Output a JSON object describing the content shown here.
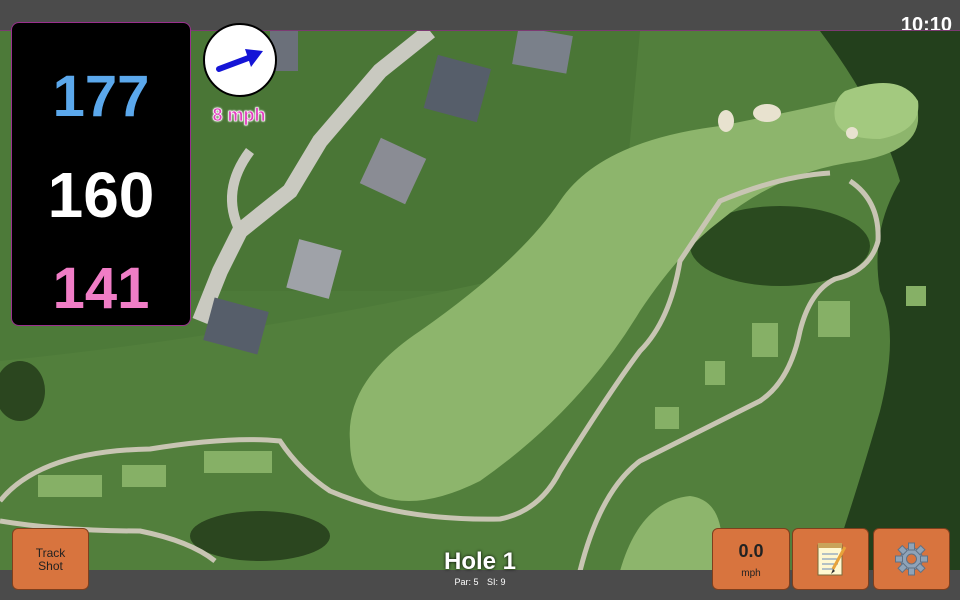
{
  "clock": "10:10",
  "yardages": {
    "back": "177",
    "middle": "160",
    "front": "141"
  },
  "wind": {
    "speed_label": "8 mph",
    "direction_icon": "wind-arrow-icon"
  },
  "buttons": {
    "track_line1": "Track",
    "track_line2": "Shot",
    "speed_value": "0.0",
    "speed_unit": "mph",
    "notes_icon": "notepad-icon",
    "settings_icon": "gear-icon"
  },
  "hole": {
    "title": "Hole 1",
    "par": "Par: 5",
    "si": "SI: 9"
  },
  "colors": {
    "back": "#5ba8ec",
    "middle": "#ffffff",
    "front": "#f07dc6",
    "button": "#d8743e"
  }
}
